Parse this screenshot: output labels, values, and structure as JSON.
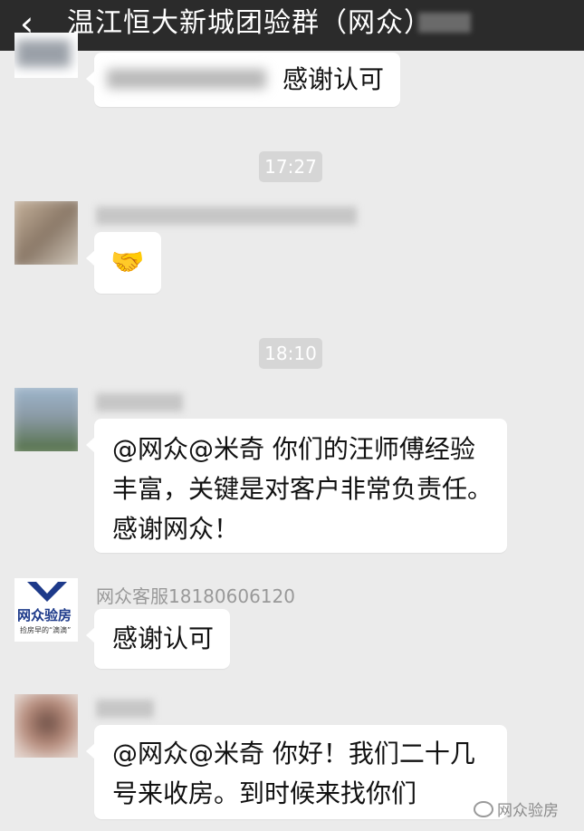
{
  "header": {
    "back_icon": "‹",
    "title": "温江恒大新城团验群（网众）"
  },
  "messages": [
    {
      "text": "感谢认可"
    },
    {
      "time": "17:27"
    },
    {
      "emoji": "🤝",
      "emoji_name": "handshake-emoji"
    },
    {
      "time": "18:10"
    },
    {
      "text_lines": [
        "@网众@米奇  你们的汪师傅经验",
        "丰富，关键是对客户非常负责任。",
        "感谢网众！"
      ]
    },
    {
      "sender": "网众客服18180606120",
      "text": "感谢认可"
    },
    {
      "text_lines": [
        "@网众@米奇  你好！我们二十几",
        "号来收房。到时候来找你们"
      ]
    }
  ],
  "logo": {
    "name": "网众验房",
    "slogan": "捡房早的“滴滴”"
  },
  "watermark": {
    "text": "网众验房"
  },
  "colors": {
    "titlebar": "#2b2b2b",
    "background": "#ebebeb",
    "logo_blue": "#1d3a8a"
  }
}
